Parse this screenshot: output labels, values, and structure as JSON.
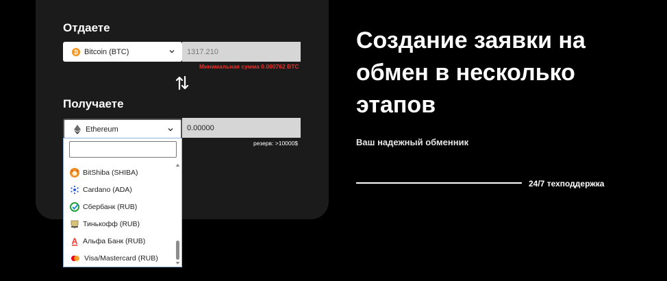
{
  "give": {
    "label": "Отдаете",
    "currency": "Bitcoin (BTC)",
    "amount": "1317.210",
    "min_note": "Минимальная сумма 0.000762 BTC"
  },
  "receive": {
    "label": "Получаете",
    "currency": "Ethereum",
    "amount": "0.00000",
    "reserve_note": "резерв: >10000$"
  },
  "dropdown": {
    "search_value": "",
    "items": [
      {
        "label": "BitShiba (SHIBA)",
        "icon": "shiba-icon"
      },
      {
        "label": "Cardano (ADA)",
        "icon": "cardano-icon"
      },
      {
        "label": "Сбербанк (RUB)",
        "icon": "sberbank-icon"
      },
      {
        "label": "Тинькофф (RUB)",
        "icon": "tinkoff-icon"
      },
      {
        "label": "Альфа Банк (RUB)",
        "icon": "alfa-bank-icon"
      },
      {
        "label": "Visa/Mastercard (RUB)",
        "icon": "mastercard-icon"
      }
    ]
  },
  "hero": {
    "title": "Создание заявки на обмен в несколько этапов",
    "subtitle": "Ваш надежный обменник",
    "support": "24/7 техподдержка"
  },
  "colors": {
    "background": "#000000",
    "card": "#1b1b1b",
    "error": "#e8312a",
    "bitcoin": "#f7931a"
  }
}
